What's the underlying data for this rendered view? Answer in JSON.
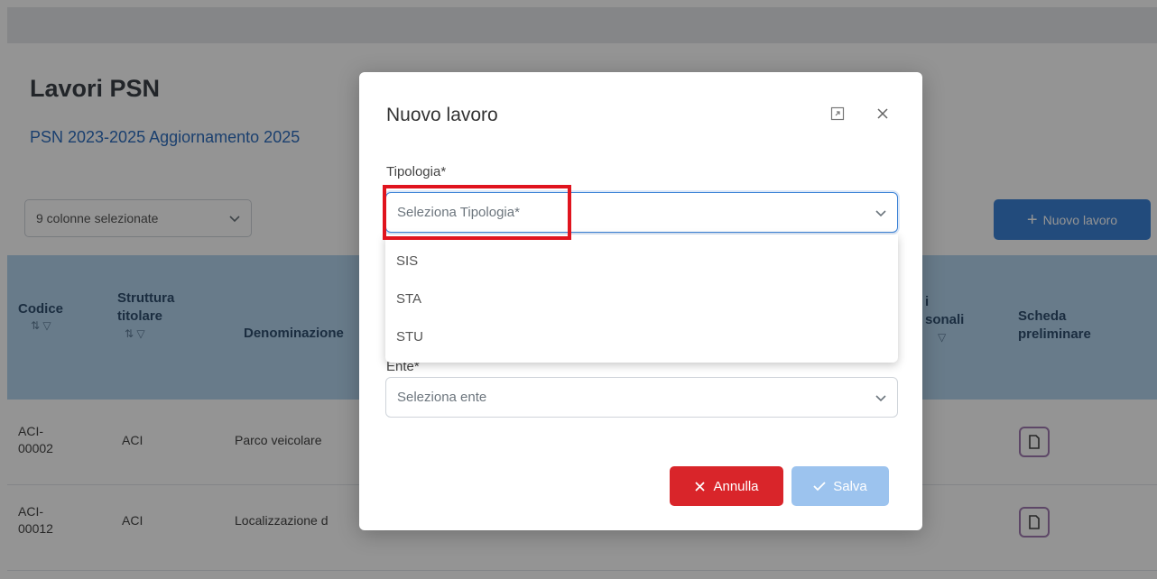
{
  "page": {
    "title": "Lavori PSN",
    "subtitle": "PSN 2023-2025 Aggiornamento 2025"
  },
  "toolbar": {
    "columns_select_label": "9 colonne selezionate",
    "new_button_label": "Nuovo lavoro"
  },
  "table": {
    "headers": {
      "code": "Codice",
      "structure": "Struttura titolare",
      "name": "Denominazione",
      "personal": "sonali",
      "personal_prefix": "i",
      "scheda": "Scheda preliminare"
    },
    "rows": [
      {
        "code": "ACI-00002",
        "structure": "ACI",
        "name": "Parco veicolare"
      },
      {
        "code": "ACI-00012",
        "structure": "ACI",
        "name": "Localizzazione d"
      }
    ]
  },
  "modal": {
    "title": "Nuovo lavoro",
    "tipologia": {
      "label": "Tipologia*",
      "placeholder": "Seleziona Tipologia*",
      "options": [
        "SIS",
        "STA",
        "STU"
      ]
    },
    "ente": {
      "label": "Ente*",
      "placeholder": "Seleziona ente"
    },
    "cancel_label": "Annulla",
    "save_label": "Salva"
  },
  "colors": {
    "primary": "#3b82d6",
    "danger": "#d9252a",
    "highlight": "#e0141e",
    "table_header": "#b4d4ee"
  },
  "icons": {
    "expand": "expand-icon",
    "close": "close-icon",
    "chevron": "chevron-down-icon",
    "sort": "sort-icon",
    "filter": "filter-icon",
    "document": "document-icon",
    "plus": "plus-icon",
    "check": "check-icon",
    "times": "times-icon"
  }
}
